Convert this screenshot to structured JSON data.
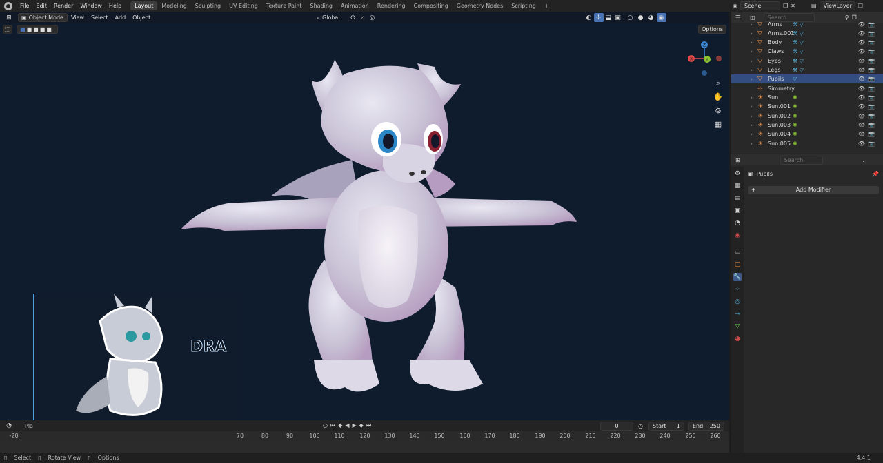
{
  "menus": [
    "File",
    "Edit",
    "Render",
    "Window",
    "Help"
  ],
  "workspaces": [
    "Layout",
    "Modeling",
    "Sculpting",
    "UV Editing",
    "Texture Paint",
    "Shading",
    "Animation",
    "Rendering",
    "Compositing",
    "Geometry Nodes",
    "Scripting"
  ],
  "active_workspace": "Layout",
  "add_workspace": "+",
  "scene": "Scene",
  "view_layer": "ViewLayer",
  "viewport": {
    "mode": "Object Mode",
    "menus": [
      "View",
      "Select",
      "Add",
      "Object"
    ],
    "transform": "Global",
    "options": "Options"
  },
  "gizmo": {
    "x": "X",
    "y": "Y",
    "z": "Z"
  },
  "outliner": {
    "search_placeholder": "Search",
    "items": [
      {
        "name": "Arms",
        "type": "mesh"
      },
      {
        "name": "Arms.001",
        "type": "mesh"
      },
      {
        "name": "Body",
        "type": "mesh"
      },
      {
        "name": "Claws",
        "type": "mesh"
      },
      {
        "name": "Eyes",
        "type": "mesh"
      },
      {
        "name": "Legs",
        "type": "mesh"
      },
      {
        "name": "Pupils",
        "type": "mesh"
      },
      {
        "name": "Simmetry",
        "type": "empty"
      },
      {
        "name": "Sun",
        "type": "light"
      },
      {
        "name": "Sun.001",
        "type": "light"
      },
      {
        "name": "Sun.002",
        "type": "light"
      },
      {
        "name": "Sun.003",
        "type": "light"
      },
      {
        "name": "Sun.004",
        "type": "light"
      },
      {
        "name": "Sun.005",
        "type": "light"
      }
    ]
  },
  "properties": {
    "search_placeholder": "Search",
    "object": "Pupils",
    "add_modifier": "Add Modifier"
  },
  "timeline": {
    "playback": "Pla",
    "current_frame": "0",
    "start_label": "Start",
    "start": "1",
    "end_label": "End",
    "end": "250",
    "ticks": [
      "-20",
      "70",
      "80",
      "90",
      "100",
      "110",
      "120",
      "130",
      "140",
      "150",
      "160",
      "170",
      "180",
      "190",
      "200",
      "210",
      "220",
      "230",
      "240",
      "250",
      "260"
    ]
  },
  "overlay_text": "DRA",
  "status": {
    "select": "Select",
    "rotate": "Rotate View",
    "options": "Options",
    "version": "4.4.1"
  },
  "colors": {
    "viewport_bg": "#0f1c2e",
    "accent": "#4772b3",
    "x_axis": "#e04a4a",
    "y_axis": "#8ac531",
    "z_axis": "#3d85d6"
  }
}
